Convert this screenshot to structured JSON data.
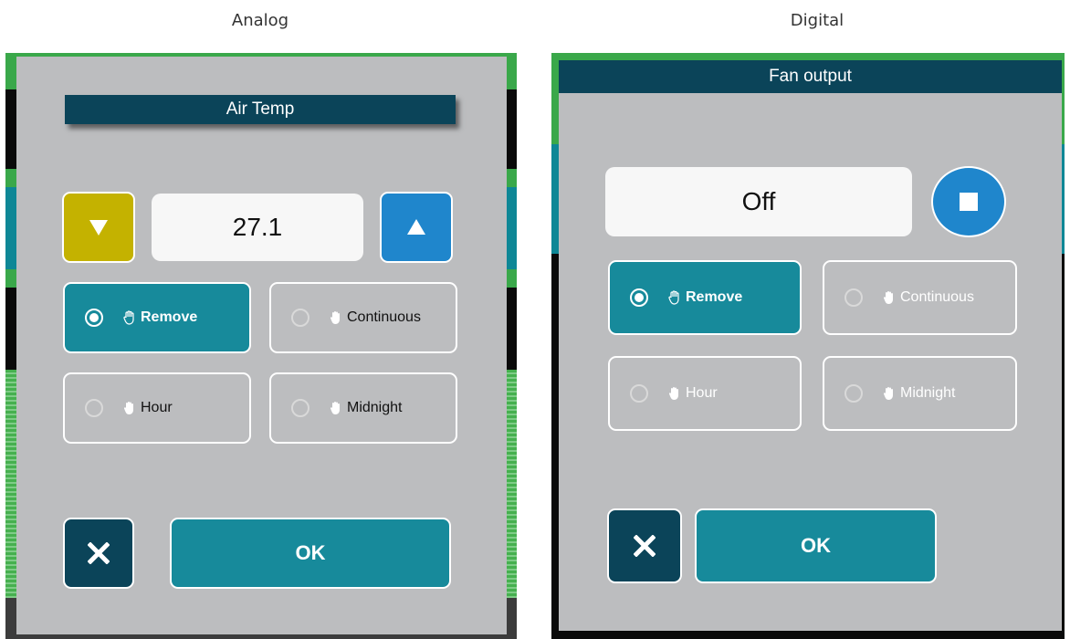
{
  "captions": {
    "left": "Analog",
    "right": "Digital"
  },
  "analog": {
    "title": "Air Temp",
    "value": "27.1",
    "options": [
      "Remove",
      "Continuous",
      "Hour",
      "Midnight"
    ],
    "selected": "Remove",
    "ok_label": "OK"
  },
  "digital": {
    "title": "Fan output",
    "value": "Off",
    "options": [
      "Remove",
      "Continuous",
      "Hour",
      "Midnight"
    ],
    "selected": "Remove",
    "ok_label": "OK"
  },
  "colors": {
    "panel": "#bcbdbf",
    "title_bar": "#0b4459",
    "selected_option": "#178a9b",
    "down_button": "#c4b200",
    "up_button": "#1f86cc",
    "cancel_button": "#0b4459"
  },
  "icons": [
    "chevron-down-icon",
    "chevron-up-icon",
    "stop-icon",
    "close-icon",
    "hand-icon"
  ]
}
